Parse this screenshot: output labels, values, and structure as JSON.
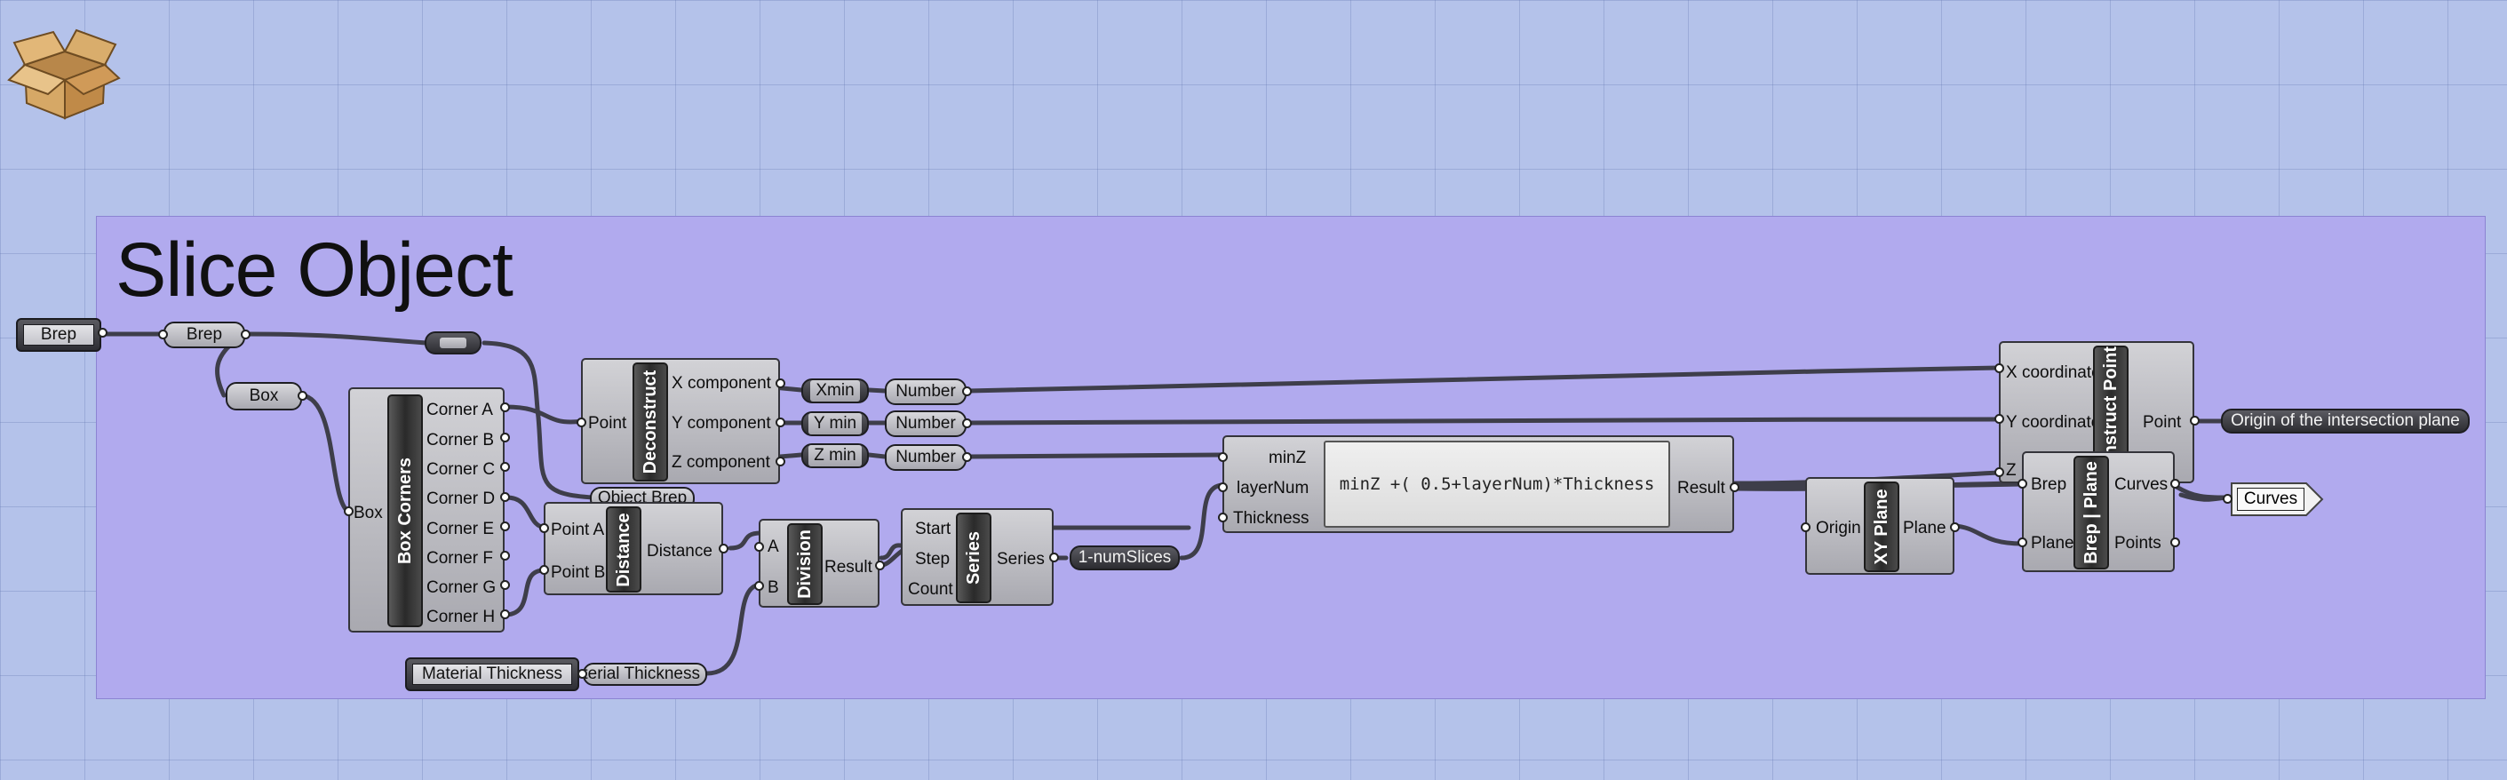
{
  "group": {
    "title": "Slice Object"
  },
  "params": {
    "brep_outer": "Brep",
    "brep": "Brep",
    "box": "Box",
    "xmin": "Xmin",
    "ymin": "Y min",
    "zmin": "Z min",
    "object_brep": "Object Brep",
    "material_thickness_param": "Material Thickness",
    "material_thickness_relay": "Material Thickness",
    "num_slices": "1-numSlices",
    "origin_plane": "Origin of the intersection plane",
    "curves_out": "Curves",
    "number_x": "Number",
    "number_y": "Number",
    "number_z": "Number"
  },
  "box_corners": {
    "name": "Box Corners",
    "input": "Box",
    "outputs": [
      "Corner A",
      "Corner B",
      "Corner C",
      "Corner D",
      "Corner E",
      "Corner F",
      "Corner G",
      "Corner H"
    ]
  },
  "deconstruct": {
    "name": "Deconstruct",
    "input": "Point",
    "outputs": [
      "X component",
      "Y component",
      "Z component"
    ]
  },
  "distance": {
    "name": "Distance",
    "inputs": [
      "Point A",
      "Point B"
    ],
    "output": "Distance"
  },
  "division": {
    "name": "Division",
    "inputs": [
      "A",
      "B"
    ],
    "output": "Result"
  },
  "series": {
    "name": "Series",
    "inputs": [
      "Start",
      "Step",
      "Count"
    ],
    "output": "Series"
  },
  "expression": {
    "inputs": [
      "minZ",
      "layerNum",
      "Thickness"
    ],
    "formula": "minZ +( 0.5+layerNum)*Thickness",
    "output": "Result"
  },
  "construct_point": {
    "name": "Construct Point",
    "inputs": [
      "X coordinate",
      "Y coordinate",
      "Z"
    ],
    "output": "Point"
  },
  "xy_plane": {
    "name": "XY Plane",
    "input": "Origin",
    "output": "Plane"
  },
  "brep_plane": {
    "name": "Brep | Plane",
    "inputs": [
      "Brep",
      "Plane"
    ],
    "outputs": [
      "Curves",
      "Points"
    ]
  },
  "icons": {
    "box_icon": "cardboard-box-icon"
  }
}
